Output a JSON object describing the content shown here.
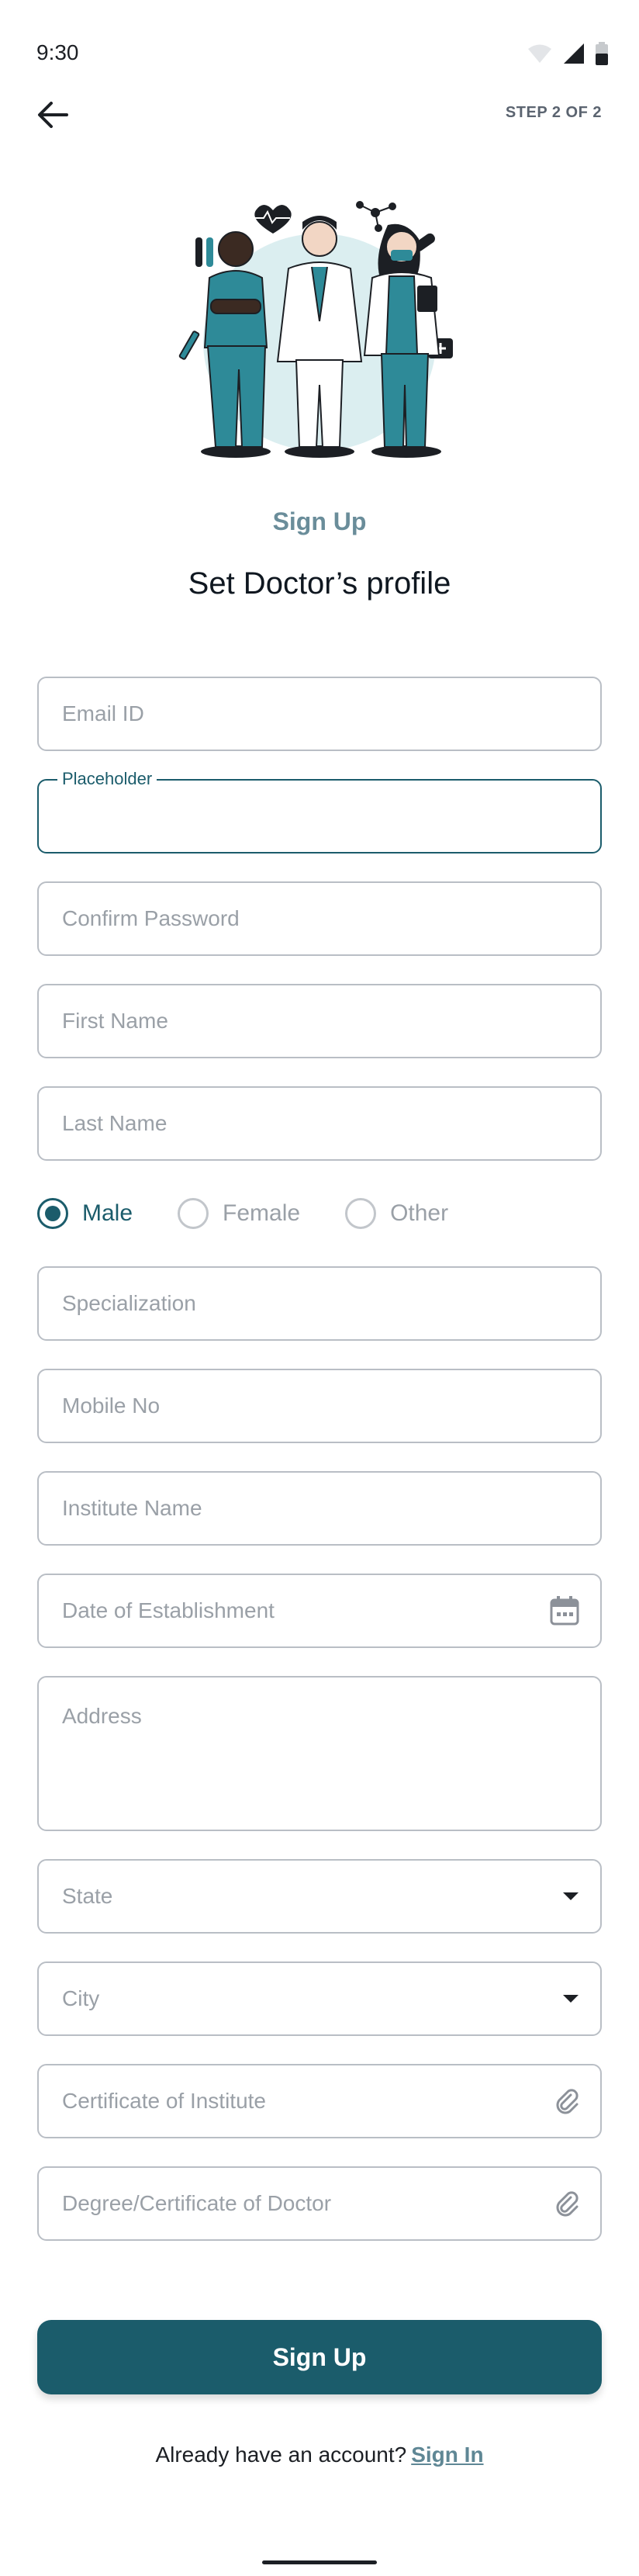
{
  "status_bar": {
    "time": "9:30"
  },
  "header": {
    "step": "STEP 2 OF 2"
  },
  "intro": {
    "eyebrow": "Sign Up",
    "title": "Set Doctor’s profile"
  },
  "form": {
    "email": {
      "placeholder": "Email ID",
      "value": ""
    },
    "password": {
      "label": "Placeholder",
      "value": ""
    },
    "confirm_password": {
      "placeholder": "Confirm Password",
      "value": ""
    },
    "first_name": {
      "placeholder": "First Name",
      "value": ""
    },
    "last_name": {
      "placeholder": "Last Name",
      "value": ""
    },
    "gender": {
      "selected": "Male",
      "options": [
        "Male",
        "Female",
        "Other"
      ]
    },
    "specialization": {
      "placeholder": "Specialization",
      "value": ""
    },
    "mobile": {
      "placeholder": "Mobile No",
      "value": ""
    },
    "institute_name": {
      "placeholder": "Institute Name",
      "value": ""
    },
    "establishment_date": {
      "placeholder": "Date of Establishment",
      "icon": "calendar-icon"
    },
    "address": {
      "placeholder": "Address",
      "value": ""
    },
    "state": {
      "placeholder": "State",
      "icon": "dropdown-arrow-icon"
    },
    "city": {
      "placeholder": "City",
      "icon": "dropdown-arrow-icon"
    },
    "certificate_institute": {
      "placeholder": "Certificate of Institute",
      "icon": "attachment-icon"
    },
    "certificate_doctor": {
      "placeholder": "Degree/Certificate of Doctor",
      "icon": "attachment-icon"
    }
  },
  "actions": {
    "submit_label": "Sign Up"
  },
  "footer": {
    "prompt": "Already have an account?",
    "link": "Sign In"
  },
  "colors": {
    "primary": "#1b5c6b",
    "accent_text": "#6a8d9a",
    "border": "#b9bec5",
    "placeholder": "#9aa0a7",
    "teal_figure": "#2e8a98",
    "illustration_bg": "#dbeef0"
  }
}
